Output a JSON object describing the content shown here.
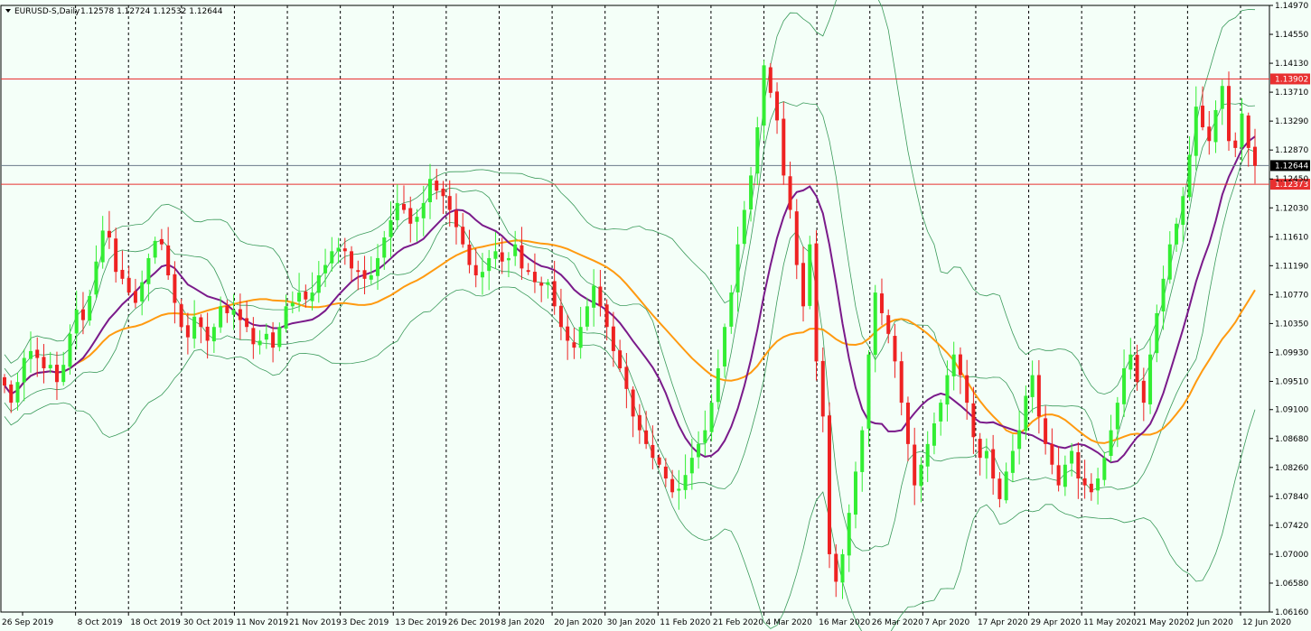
{
  "header": {
    "symbol": "EURUSD-S,Daily",
    "ohlc": "1.12578 1.12724 1.12532 1.12644"
  },
  "colors": {
    "background": "#f4fff8",
    "bull": "#33ee33",
    "bear": "#ee2222",
    "ma_fast": "#7a1a8a",
    "ma_slow": "#ff9a10",
    "bands": "#3a9a5a",
    "level_line": "#e83030",
    "price_line": "#6a7a8a"
  },
  "chart_data": {
    "type": "candlestick",
    "ylim": [
      1.0616,
      1.1497
    ],
    "y_ticks": [
      "1.14970",
      "1.14550",
      "1.14130",
      "1.13710",
      "1.13290",
      "1.12870",
      "1.12450",
      "1.12030",
      "1.11610",
      "1.11190",
      "1.10770",
      "1.10350",
      "1.09930",
      "1.09510",
      "1.09100",
      "1.08680",
      "1.08260",
      "1.07840",
      "1.07420",
      "1.07000",
      "1.06580",
      "1.06160"
    ],
    "x_labels": [
      "26 Sep 2019",
      "8 Oct 2019",
      "18 Oct 2019",
      "30 Oct 2019",
      "11 Nov 2019",
      "21 Nov 2019",
      "3 Dec 2019",
      "13 Dec 2019",
      "26 Dec 2019",
      "8 Jan 2020",
      "20 Jan 2020",
      "30 Jan 2020",
      "11 Feb 2020",
      "21 Feb 2020",
      "4 Mar 2020",
      "16 Mar 2020",
      "26 Mar 2020",
      "7 Apr 2020",
      "17 Apr 2020",
      "29 Apr 2020",
      "11 May 2020",
      "21 May 2020",
      "2 Jun 2020",
      "12 Jun 2020"
    ],
    "levels": [
      {
        "label": "1.13902",
        "value": 1.13902,
        "kind": "level"
      },
      {
        "label": "1.12373",
        "value": 1.12373,
        "kind": "level"
      },
      {
        "label": "1.12644",
        "value": 1.12644,
        "kind": "current"
      }
    ],
    "series_closes": [
      1.0945,
      1.092,
      1.095,
      1.0985,
      1.0995,
      1.0985,
      1.097,
      1.0975,
      1.095,
      1.0975,
      1.102,
      1.1055,
      1.104,
      1.1075,
      1.1125,
      1.117,
      1.116,
      1.111,
      1.11,
      1.108,
      1.1065,
      1.1095,
      1.113,
      1.1155,
      1.115,
      1.1105,
      1.1065,
      1.103,
      1.1015,
      1.1045,
      1.103,
      1.101,
      1.103,
      1.106,
      1.105,
      1.1055,
      1.104,
      1.103,
      1.1005,
      1.101,
      1.102,
      1.1,
      1.103,
      1.106,
      1.1065,
      1.108,
      1.107,
      1.108,
      1.1105,
      1.112,
      1.114,
      1.1145,
      1.114,
      1.1115,
      1.111,
      1.11,
      1.1105,
      1.113,
      1.116,
      1.1185,
      1.121,
      1.12,
      1.118,
      1.119,
      1.121,
      1.1245,
      1.1228,
      1.122,
      1.12,
      1.1175,
      1.115,
      1.112,
      1.1105,
      1.111,
      1.113,
      1.114,
      1.1125,
      1.113,
      1.115,
      1.1115,
      1.111,
      1.1095,
      1.109,
      1.1095,
      1.106,
      1.103,
      1.101,
      1.1,
      1.103,
      1.106,
      1.109,
      1.106,
      1.103,
      1.0995,
      1.097,
      1.094,
      1.09,
      1.088,
      1.086,
      1.084,
      1.083,
      1.081,
      1.079,
      1.0795,
      1.0815,
      1.084,
      1.086,
      1.088,
      1.092,
      1.097,
      1.103,
      1.108,
      1.115,
      1.12,
      1.125,
      1.132,
      1.141,
      1.137,
      1.133,
      1.125,
      1.12,
      1.112,
      1.106,
      1.115,
      1.098,
      1.09,
      1.07,
      1.066,
      1.07,
      1.076,
      1.082,
      1.088,
      1.099,
      1.108,
      1.105,
      1.102,
      1.098,
      1.092,
      1.086,
      1.08,
      1.083,
      1.086,
      1.089,
      1.092,
      1.096,
      1.099,
      1.096,
      1.092,
      1.087,
      1.084,
      1.085,
      1.081,
      1.078,
      1.082,
      1.085,
      1.088,
      1.093,
      1.096,
      1.09,
      1.086,
      1.083,
      1.08,
      1.083,
      1.085,
      1.081,
      1.08,
      1.079,
      1.081,
      1.084,
      1.088,
      1.092,
      1.097,
      1.099,
      1.095,
      1.092,
      1.099,
      1.105,
      1.11,
      1.115,
      1.118,
      1.122,
      1.128,
      1.135,
      1.132,
      1.13,
      1.1345,
      1.138,
      1.13,
      1.129,
      1.134,
      1.129,
      1.1264
    ]
  }
}
